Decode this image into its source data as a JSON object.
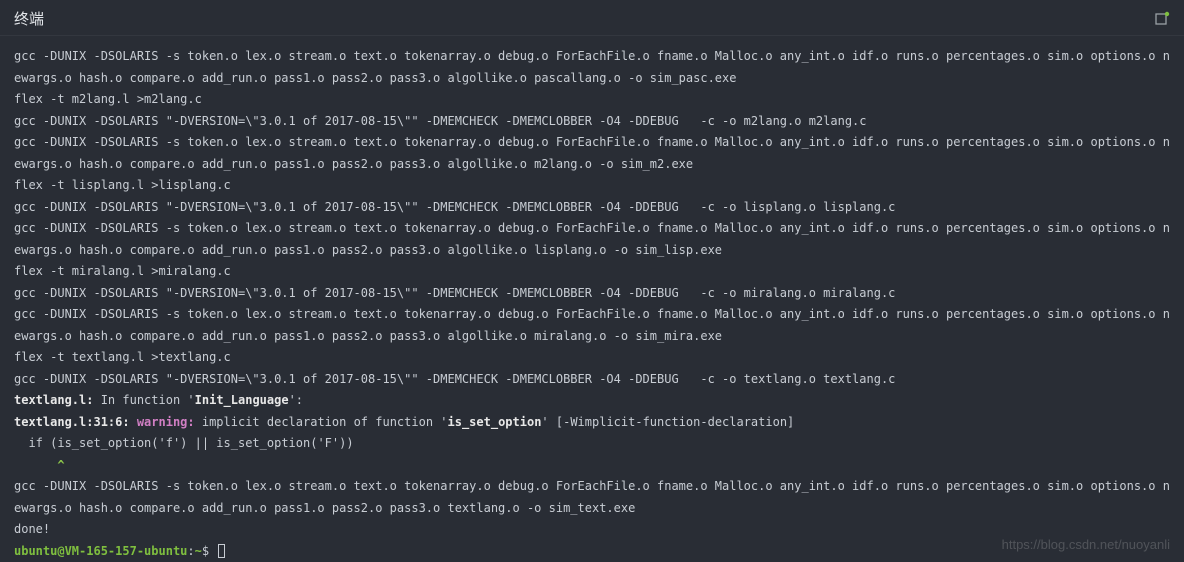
{
  "title": "终端",
  "icon_name": "maximize-icon",
  "lines": [
    {
      "segments": [
        {
          "t": "gcc -DUNIX -DSOLARIS -s token.o lex.o stream.o text.o tokenarray.o debug.o ForEachFile.o fname.o Malloc.o any_int.o idf.o runs.o percentages.o sim.o options.o newargs.o hash.o compare.o add_run.o pass1.o pass2.o pass3.o algollike.o pascallang.o -o sim_pasc.exe"
        }
      ]
    },
    {
      "segments": [
        {
          "t": "flex -t m2lang.l >m2lang.c"
        }
      ]
    },
    {
      "segments": [
        {
          "t": "gcc -DUNIX -DSOLARIS \"-DVERSION=\\\"3.0.1 of 2017-08-15\\\"\" -DMEMCHECK -DMEMCLOBBER -O4 -DDEBUG   -c -o m2lang.o m2lang.c"
        }
      ]
    },
    {
      "segments": [
        {
          "t": "gcc -DUNIX -DSOLARIS -s token.o lex.o stream.o text.o tokenarray.o debug.o ForEachFile.o fname.o Malloc.o any_int.o idf.o runs.o percentages.o sim.o options.o newargs.o hash.o compare.o add_run.o pass1.o pass2.o pass3.o algollike.o m2lang.o -o sim_m2.exe"
        }
      ]
    },
    {
      "segments": [
        {
          "t": "flex -t lisplang.l >lisplang.c"
        }
      ]
    },
    {
      "segments": [
        {
          "t": "gcc -DUNIX -DSOLARIS \"-DVERSION=\\\"3.0.1 of 2017-08-15\\\"\" -DMEMCHECK -DMEMCLOBBER -O4 -DDEBUG   -c -o lisplang.o lisplang.c"
        }
      ]
    },
    {
      "segments": [
        {
          "t": "gcc -DUNIX -DSOLARIS -s token.o lex.o stream.o text.o tokenarray.o debug.o ForEachFile.o fname.o Malloc.o any_int.o idf.o runs.o percentages.o sim.o options.o newargs.o hash.o compare.o add_run.o pass1.o pass2.o pass3.o algollike.o lisplang.o -o sim_lisp.exe"
        }
      ]
    },
    {
      "segments": [
        {
          "t": "flex -t miralang.l >miralang.c"
        }
      ]
    },
    {
      "segments": [
        {
          "t": "gcc -DUNIX -DSOLARIS \"-DVERSION=\\\"3.0.1 of 2017-08-15\\\"\" -DMEMCHECK -DMEMCLOBBER -O4 -DDEBUG   -c -o miralang.o miralang.c"
        }
      ]
    },
    {
      "segments": [
        {
          "t": "gcc -DUNIX -DSOLARIS -s token.o lex.o stream.o text.o tokenarray.o debug.o ForEachFile.o fname.o Malloc.o any_int.o idf.o runs.o percentages.o sim.o options.o newargs.o hash.o compare.o add_run.o pass1.o pass2.o pass3.o algollike.o miralang.o -o sim_mira.exe"
        }
      ]
    },
    {
      "segments": [
        {
          "t": "flex -t textlang.l >textlang.c"
        }
      ]
    },
    {
      "segments": [
        {
          "t": "gcc -DUNIX -DSOLARIS \"-DVERSION=\\\"3.0.1 of 2017-08-15\\\"\" -DMEMCHECK -DMEMCLOBBER -O4 -DDEBUG   -c -o textlang.o textlang.c"
        }
      ]
    },
    {
      "segments": [
        {
          "t": "textlang.l:",
          "cls": "bold"
        },
        {
          "t": " In function '"
        },
        {
          "t": "Init_Language",
          "cls": "bold"
        },
        {
          "t": "':"
        }
      ]
    },
    {
      "segments": [
        {
          "t": "textlang.l:31:6: ",
          "cls": "bold"
        },
        {
          "t": "warning:",
          "cls": "pink"
        },
        {
          "t": " implicit declaration of function '"
        },
        {
          "t": "is_set_option",
          "cls": "bold"
        },
        {
          "t": "' [-Wimplicit-function-declaration]"
        }
      ]
    },
    {
      "segments": [
        {
          "t": "  if (is_set_option('f') || is_set_option('F'))"
        }
      ]
    },
    {
      "segments": [
        {
          "t": "      "
        },
        {
          "t": "^",
          "cls": "caret"
        }
      ]
    },
    {
      "segments": [
        {
          "t": "gcc -DUNIX -DSOLARIS -s token.o lex.o stream.o text.o tokenarray.o debug.o ForEachFile.o fname.o Malloc.o any_int.o idf.o runs.o percentages.o sim.o options.o newargs.o hash.o compare.o add_run.o pass1.o pass2.o pass3.o textlang.o -o sim_text.exe"
        }
      ]
    },
    {
      "segments": [
        {
          "t": "done!"
        }
      ]
    }
  ],
  "prompt": {
    "user_host": "ubuntu@VM-165-157-ubuntu",
    "sep": ":",
    "path": "~",
    "symbol": "$"
  },
  "watermark": "https://blog.csdn.net/nuoyanli"
}
